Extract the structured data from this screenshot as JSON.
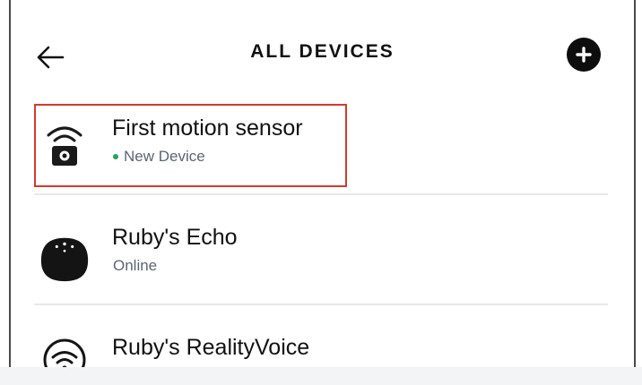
{
  "header": {
    "title": "ALL DEVICES",
    "back_icon": "back-arrow-icon",
    "add_icon": "plus-circle-icon"
  },
  "devices": [
    {
      "name": "First motion sensor",
      "status": "New Device",
      "icon": "motion-sensor-icon",
      "status_color": "#2aa05a"
    },
    {
      "name": "Ruby's Echo",
      "status": "Online",
      "icon": "echo-dot-icon"
    },
    {
      "name": "Ruby's RealityVoice",
      "status": "",
      "icon": "wifi-circle-icon"
    }
  ],
  "colors": {
    "highlight_border": "#d13b2f",
    "status_dot": "#2aa05a",
    "text_primary": "#111111",
    "text_secondary": "#5b6570"
  }
}
